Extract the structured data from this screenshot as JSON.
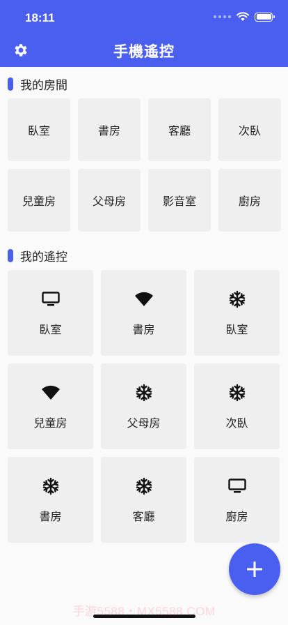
{
  "status_bar": {
    "time": "18:11"
  },
  "header": {
    "title": "手機遙控"
  },
  "rooms_section": {
    "title": "我的房間",
    "items": [
      {
        "label": "臥室"
      },
      {
        "label": "書房"
      },
      {
        "label": "客廳"
      },
      {
        "label": "次臥"
      },
      {
        "label": "兒童房"
      },
      {
        "label": "父母房"
      },
      {
        "label": "影音室"
      },
      {
        "label": "廚房"
      }
    ]
  },
  "remotes_section": {
    "title": "我的遙控",
    "items": [
      {
        "label": "臥室",
        "icon": "tv-icon"
      },
      {
        "label": "書房",
        "icon": "wifi-icon"
      },
      {
        "label": "臥室",
        "icon": "snowflake-icon"
      },
      {
        "label": "兒童房",
        "icon": "wifi-icon"
      },
      {
        "label": "父母房",
        "icon": "snowflake-icon"
      },
      {
        "label": "次臥",
        "icon": "snowflake-icon"
      },
      {
        "label": "書房",
        "icon": "snowflake-icon"
      },
      {
        "label": "客廳",
        "icon": "snowflake-icon"
      },
      {
        "label": "廚房",
        "icon": "tv-icon"
      }
    ]
  },
  "fab": {
    "icon": "plus-icon"
  },
  "watermark": "手游5588・MX5588.COM",
  "colors": {
    "accent": "#4a5ff0",
    "tile": "#efefef",
    "background": "#fafafa"
  }
}
